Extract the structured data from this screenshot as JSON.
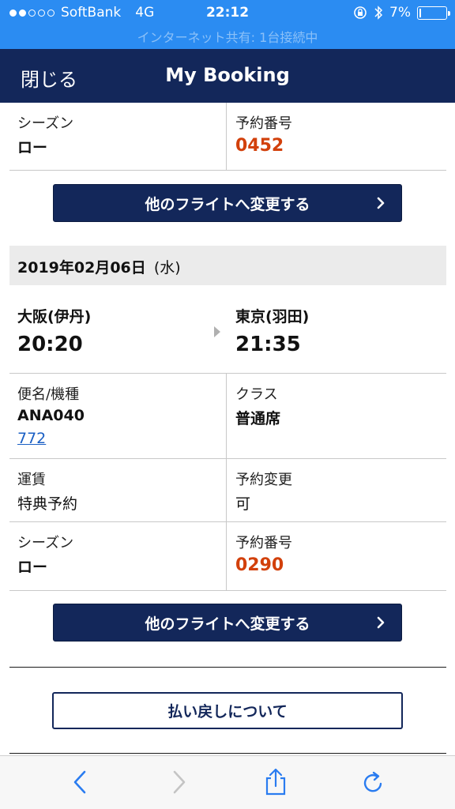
{
  "status_bar": {
    "carrier": "SoftBank",
    "network": "4G",
    "time": "22:12",
    "battery": "7%",
    "battery_level": 0.07,
    "hotspot": "インターネット共有: 1台接続中"
  },
  "nav": {
    "close": "閉じる",
    "title": "My Booking"
  },
  "segment1": {
    "season_label": "シーズン",
    "season_value": "ロー",
    "booking_label": "予約番号",
    "booking_value": "0452",
    "change_button": "他のフライトへ変更する"
  },
  "segment2": {
    "date": "2019年02月06日",
    "weekday": "(水)",
    "from_airport": "大阪(伊丹)",
    "from_time": "20:20",
    "to_airport": "東京(羽田)",
    "to_time": "21:35",
    "flight_label": "便名/機種",
    "flight_number": "ANA040",
    "aircraft": "772",
    "class_label": "クラス",
    "class_value": "普通席",
    "fare_label": "運賃",
    "fare_value": "特典予約",
    "change_label": "予約変更",
    "change_value": "可",
    "season_label": "シーズン",
    "season_value": "ロー",
    "booking_label": "予約番号",
    "booking_value": "0290",
    "change_button": "他のフライトへ変更する"
  },
  "refund_button": "払い戻しについて",
  "colors": {
    "status_blue": "#2b8cf2",
    "navy": "#13275a",
    "orange": "#d2400b",
    "link_blue": "#1a5fc4"
  },
  "icons": [
    "signal-dots-icon",
    "lock-rotation-icon",
    "bluetooth-icon",
    "battery-icon",
    "chevron-right-icon",
    "back-icon",
    "forward-icon",
    "share-icon",
    "reload-icon"
  ]
}
